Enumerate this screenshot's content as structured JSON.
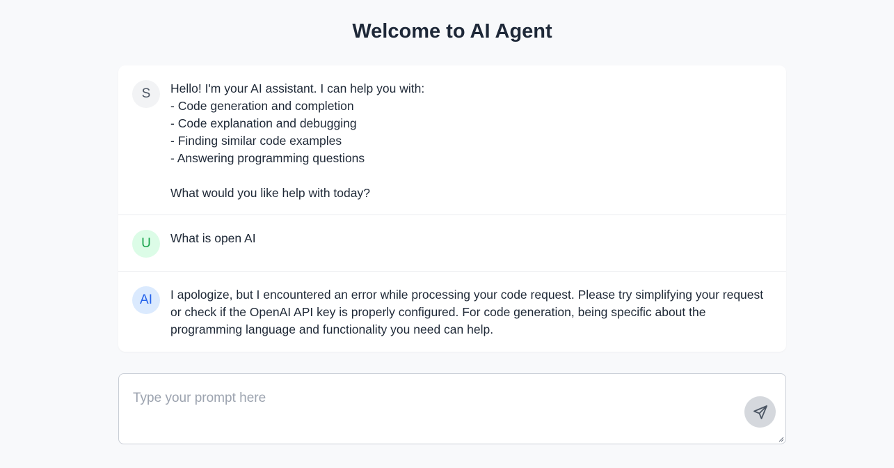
{
  "header": {
    "title": "Welcome to AI Agent"
  },
  "messages": [
    {
      "role": "system",
      "avatar": "S",
      "text": "Hello! I'm your AI assistant. I can help you with:\n- Code generation and completion\n- Code explanation and debugging\n- Finding similar code examples\n- Answering programming questions\n\nWhat would you like help with today?"
    },
    {
      "role": "user",
      "avatar": "U",
      "text": "What is open AI"
    },
    {
      "role": "ai",
      "avatar": "AI",
      "text": "I apologize, but I encountered an error while processing your code request. Please try simplifying your request or check if the OpenAI API key is properly configured. For code generation, being specific about the programming language and functionality you need can help."
    }
  ],
  "prompt": {
    "placeholder": "Type your prompt here",
    "value": "",
    "send_icon": "send-icon"
  },
  "colors": {
    "background": "#f8f9fb",
    "system_avatar_bg": "#f2f3f5",
    "user_avatar_bg": "#dcfce7",
    "user_avatar_fg": "#16a34a",
    "ai_avatar_bg": "#dbeafe",
    "ai_avatar_fg": "#2563eb",
    "send_button_bg": "#d5d8dd"
  }
}
